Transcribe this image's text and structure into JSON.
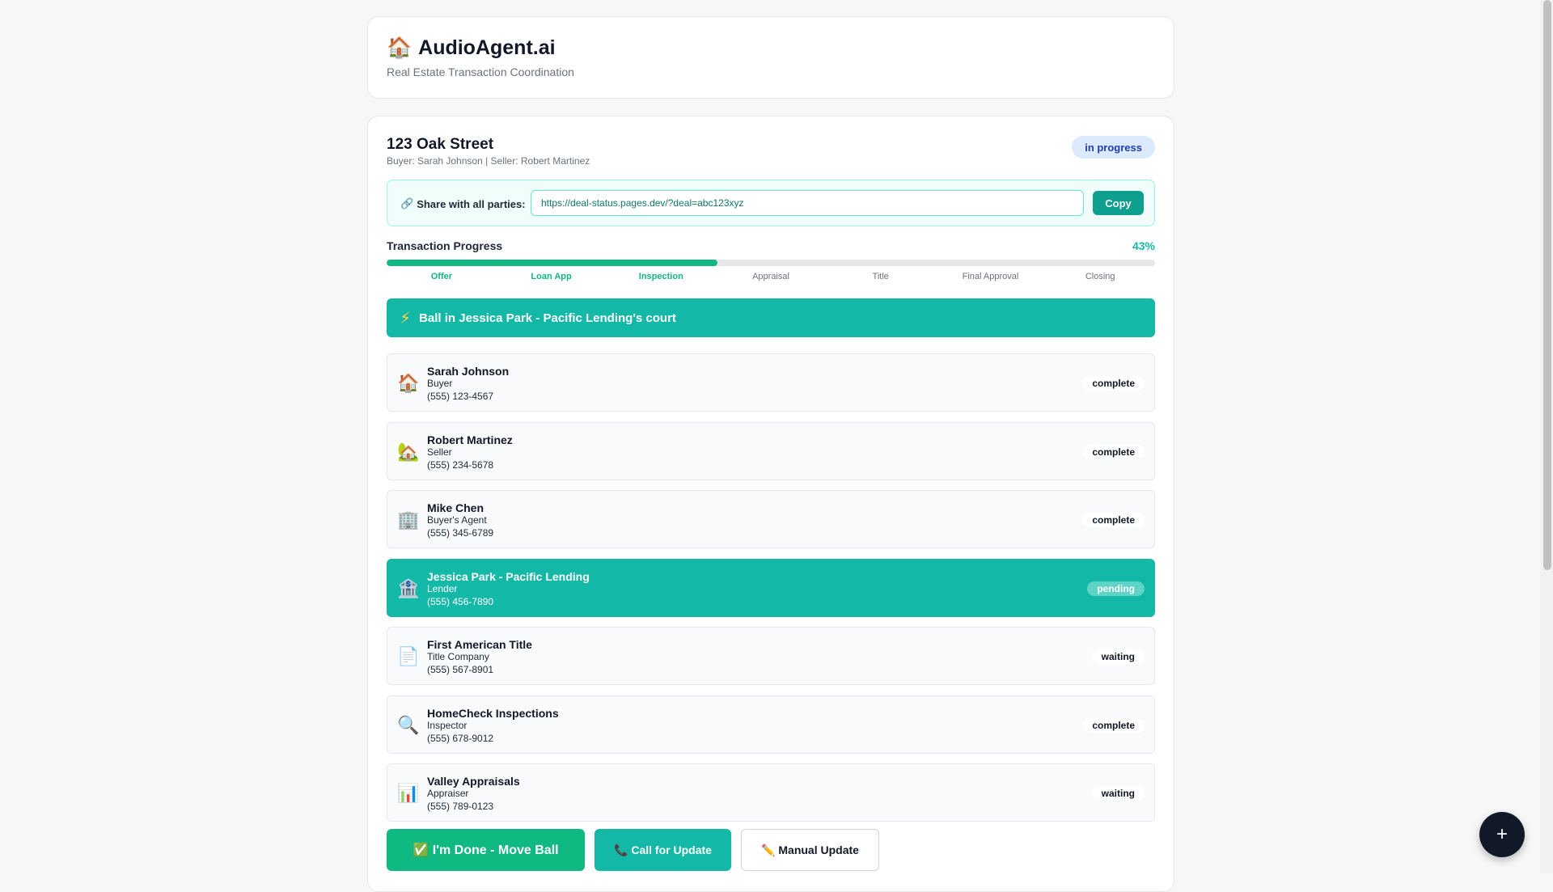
{
  "header": {
    "logo_icon": "🏠",
    "title": "AudioAgent.ai",
    "subtitle": "Real Estate Transaction Coordination"
  },
  "deal": {
    "address": "123 Oak Street",
    "parties_line": "Buyer: Sarah Johnson | Seller: Robert Martinez",
    "status": "in progress"
  },
  "share": {
    "icon": "🔗",
    "label": "Share with all parties:",
    "url": "https://deal-status.pages.dev/?deal=abc123xyz",
    "copy_label": "Copy"
  },
  "progress": {
    "label": "Transaction Progress",
    "percent_text": "43%",
    "percent": 43,
    "steps": [
      {
        "label": "Offer",
        "done": true
      },
      {
        "label": "Loan App",
        "done": true
      },
      {
        "label": "Inspection",
        "done": true
      },
      {
        "label": "Appraisal",
        "done": false
      },
      {
        "label": "Title",
        "done": false
      },
      {
        "label": "Final Approval",
        "done": false
      },
      {
        "label": "Closing",
        "done": false
      }
    ]
  },
  "ball": {
    "icon": "⚡",
    "text": "Ball in Jessica Park - Pacific Lending's court"
  },
  "parties": [
    {
      "icon": "🏠",
      "name": "Sarah Johnson",
      "role": "Buyer",
      "phone": "(555) 123-4567",
      "status": "complete",
      "active": false
    },
    {
      "icon": "🏡",
      "name": "Robert Martinez",
      "role": "Seller",
      "phone": "(555) 234-5678",
      "status": "complete",
      "active": false
    },
    {
      "icon": "🏢",
      "name": "Mike Chen",
      "role": "Buyer's Agent",
      "phone": "(555) 345-6789",
      "status": "complete",
      "active": false
    },
    {
      "icon": "🏦",
      "name": "Jessica Park - Pacific Lending",
      "role": "Lender",
      "phone": "(555) 456-7890",
      "status": "pending",
      "active": true
    },
    {
      "icon": "📄",
      "name": "First American Title",
      "role": "Title Company",
      "phone": "(555) 567-8901",
      "status": "waiting",
      "active": false
    },
    {
      "icon": "🔍",
      "name": "HomeCheck Inspections",
      "role": "Inspector",
      "phone": "(555) 678-9012",
      "status": "complete",
      "active": false
    },
    {
      "icon": "📊",
      "name": "Valley Appraisals",
      "role": "Appraiser",
      "phone": "(555) 789-0123",
      "status": "waiting",
      "active": false
    }
  ],
  "actions": {
    "done_label": "✅ I'm Done - Move Ball",
    "call_label": "📞 Call for Update",
    "manual_label": "✏️ Manual Update"
  },
  "fab": {
    "label": "+"
  }
}
